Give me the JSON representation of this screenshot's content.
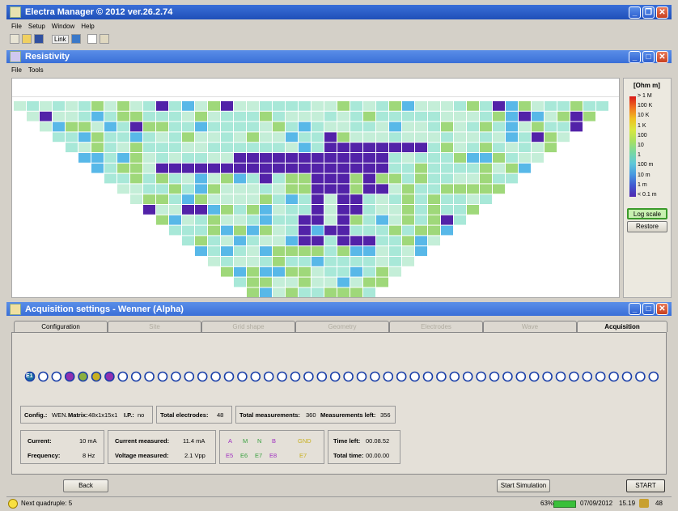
{
  "app": {
    "title": "Electra Manager © 2012 ver.26.2.74",
    "menu": [
      "File",
      "Setup",
      "Window",
      "Help"
    ],
    "toolbar_link_label": "Link"
  },
  "resistivity": {
    "title": "Resistivity",
    "menu": [
      "File",
      "Tools"
    ],
    "legend": {
      "unit": "[Ohm m]",
      "labels": [
        "> 1 M",
        "100 K",
        "10 K",
        "1 K",
        "100",
        "10",
        "1",
        "100 m",
        "10 m",
        "1 m",
        "< 0.1 m"
      ],
      "colors": [
        "#d81818",
        "#f07020",
        "#f0c020",
        "#d8e840",
        "#a8e060",
        "#78d8a0",
        "#60c8d8",
        "#4898e0",
        "#4058d0",
        "#5028b0"
      ],
      "log_scale_label": "Log scale",
      "restore_label": "Restore"
    },
    "pseudosection": {
      "cell_colors": {
        "light": "#a8e8d8",
        "mint": "#c4eed8",
        "green": "#9fd87a",
        "blue": "#58b8e8",
        "dino": "#5222a8"
      }
    }
  },
  "acquisition": {
    "title": "Acquisition settings - Wenner (Alpha)",
    "tabs": [
      "Configuration",
      "Site",
      "Grid shape",
      "Geometry",
      "Electrodes",
      "Wave",
      "Acquisition"
    ],
    "active_tab": "Acquisition",
    "electrodes": {
      "count": 48,
      "first_label": "E1",
      "colors": {
        "idle": "#1a3fa8",
        "a": "#9030b0",
        "m": "#8ab040",
        "n": "#8ab040",
        "b": "#9030b0",
        "gnd": "#c8b020"
      }
    },
    "info": {
      "config_label": "Config.:",
      "config_value": "WEN.",
      "matrix_label": "Matrix:",
      "matrix_value": "48x1x15x1",
      "ip_label": "I.P.:",
      "ip_value": "no",
      "total_electrodes_label": "Total electrodes:",
      "total_electrodes_value": "48",
      "total_measurements_label": "Total measurements:",
      "total_measurements_value": "360",
      "measurements_left_label": "Measurements left:",
      "measurements_left_value": "356",
      "current_label": "Current:",
      "current_value": "10 mA",
      "frequency_label": "Frequency:",
      "frequency_value": "8 Hz",
      "current_measured_label": "Current measured:",
      "current_measured_value": "11.4 mA",
      "voltage_measured_label": "Voltage measured:",
      "voltage_measured_value": "2.1 Vpp",
      "quad_headers": [
        "A",
        "M",
        "N",
        "B",
        "GND"
      ],
      "quad_values": [
        "E5",
        "E6",
        "E7",
        "E8",
        "E7"
      ],
      "time_left_label": "Time left:",
      "time_left_value": "00.08.52",
      "total_time_label": "Total time:",
      "total_time_value": "00.00.00"
    },
    "back_label": "Back",
    "start_simulation_label": "Start Simulation",
    "start_label": "START"
  },
  "status": {
    "message": "Next quadruple: 5",
    "battery": "63%",
    "date": "07/09/2012",
    "time": "15.19",
    "count": "48"
  }
}
